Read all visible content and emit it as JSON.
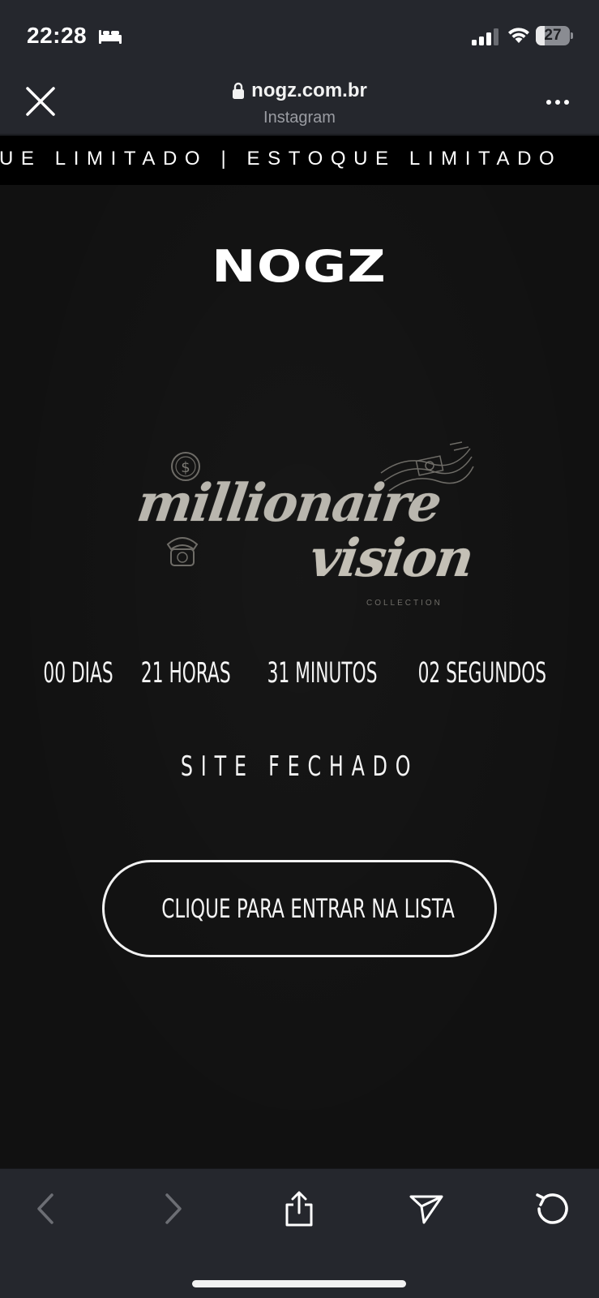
{
  "status_bar": {
    "time": "22:28",
    "sleep_icon": "bed-icon",
    "signal_icon": "cellular-signal-icon",
    "wifi_icon": "wifi-icon",
    "battery_level": "27",
    "battery_fraction": 0.27
  },
  "browser": {
    "close_icon": "close-icon",
    "lock_icon": "lock-icon",
    "url": "nogz.com.br",
    "source": "Instagram",
    "more_icon": "more-options-icon"
  },
  "marquee": {
    "text": "UE LIMITADO | ESTOQUE LIMITADO"
  },
  "page": {
    "logo_text": "NOGZ",
    "collection": {
      "line1": "millionaire",
      "line2": "vision",
      "line3": "COLLECTION"
    },
    "countdown": {
      "days": "00 DIAS",
      "hours": "21 HORAS",
      "minutes": "31 MINUTOS",
      "seconds": "02 SEGUNDOS"
    },
    "status_text": "SITE FECHADO",
    "cta_label": "CLIQUE PARA ENTRAR NA LISTA"
  },
  "toolbar": {
    "back_icon": "chevron-left-icon",
    "forward_icon": "chevron-right-icon",
    "share_icon": "share-icon",
    "send_icon": "send-icon",
    "reload_icon": "reload-icon"
  },
  "colors": {
    "chrome_background": "#25272d",
    "page_background": "#111111",
    "marquee_background": "#000000",
    "text": "#f4f4f4"
  }
}
